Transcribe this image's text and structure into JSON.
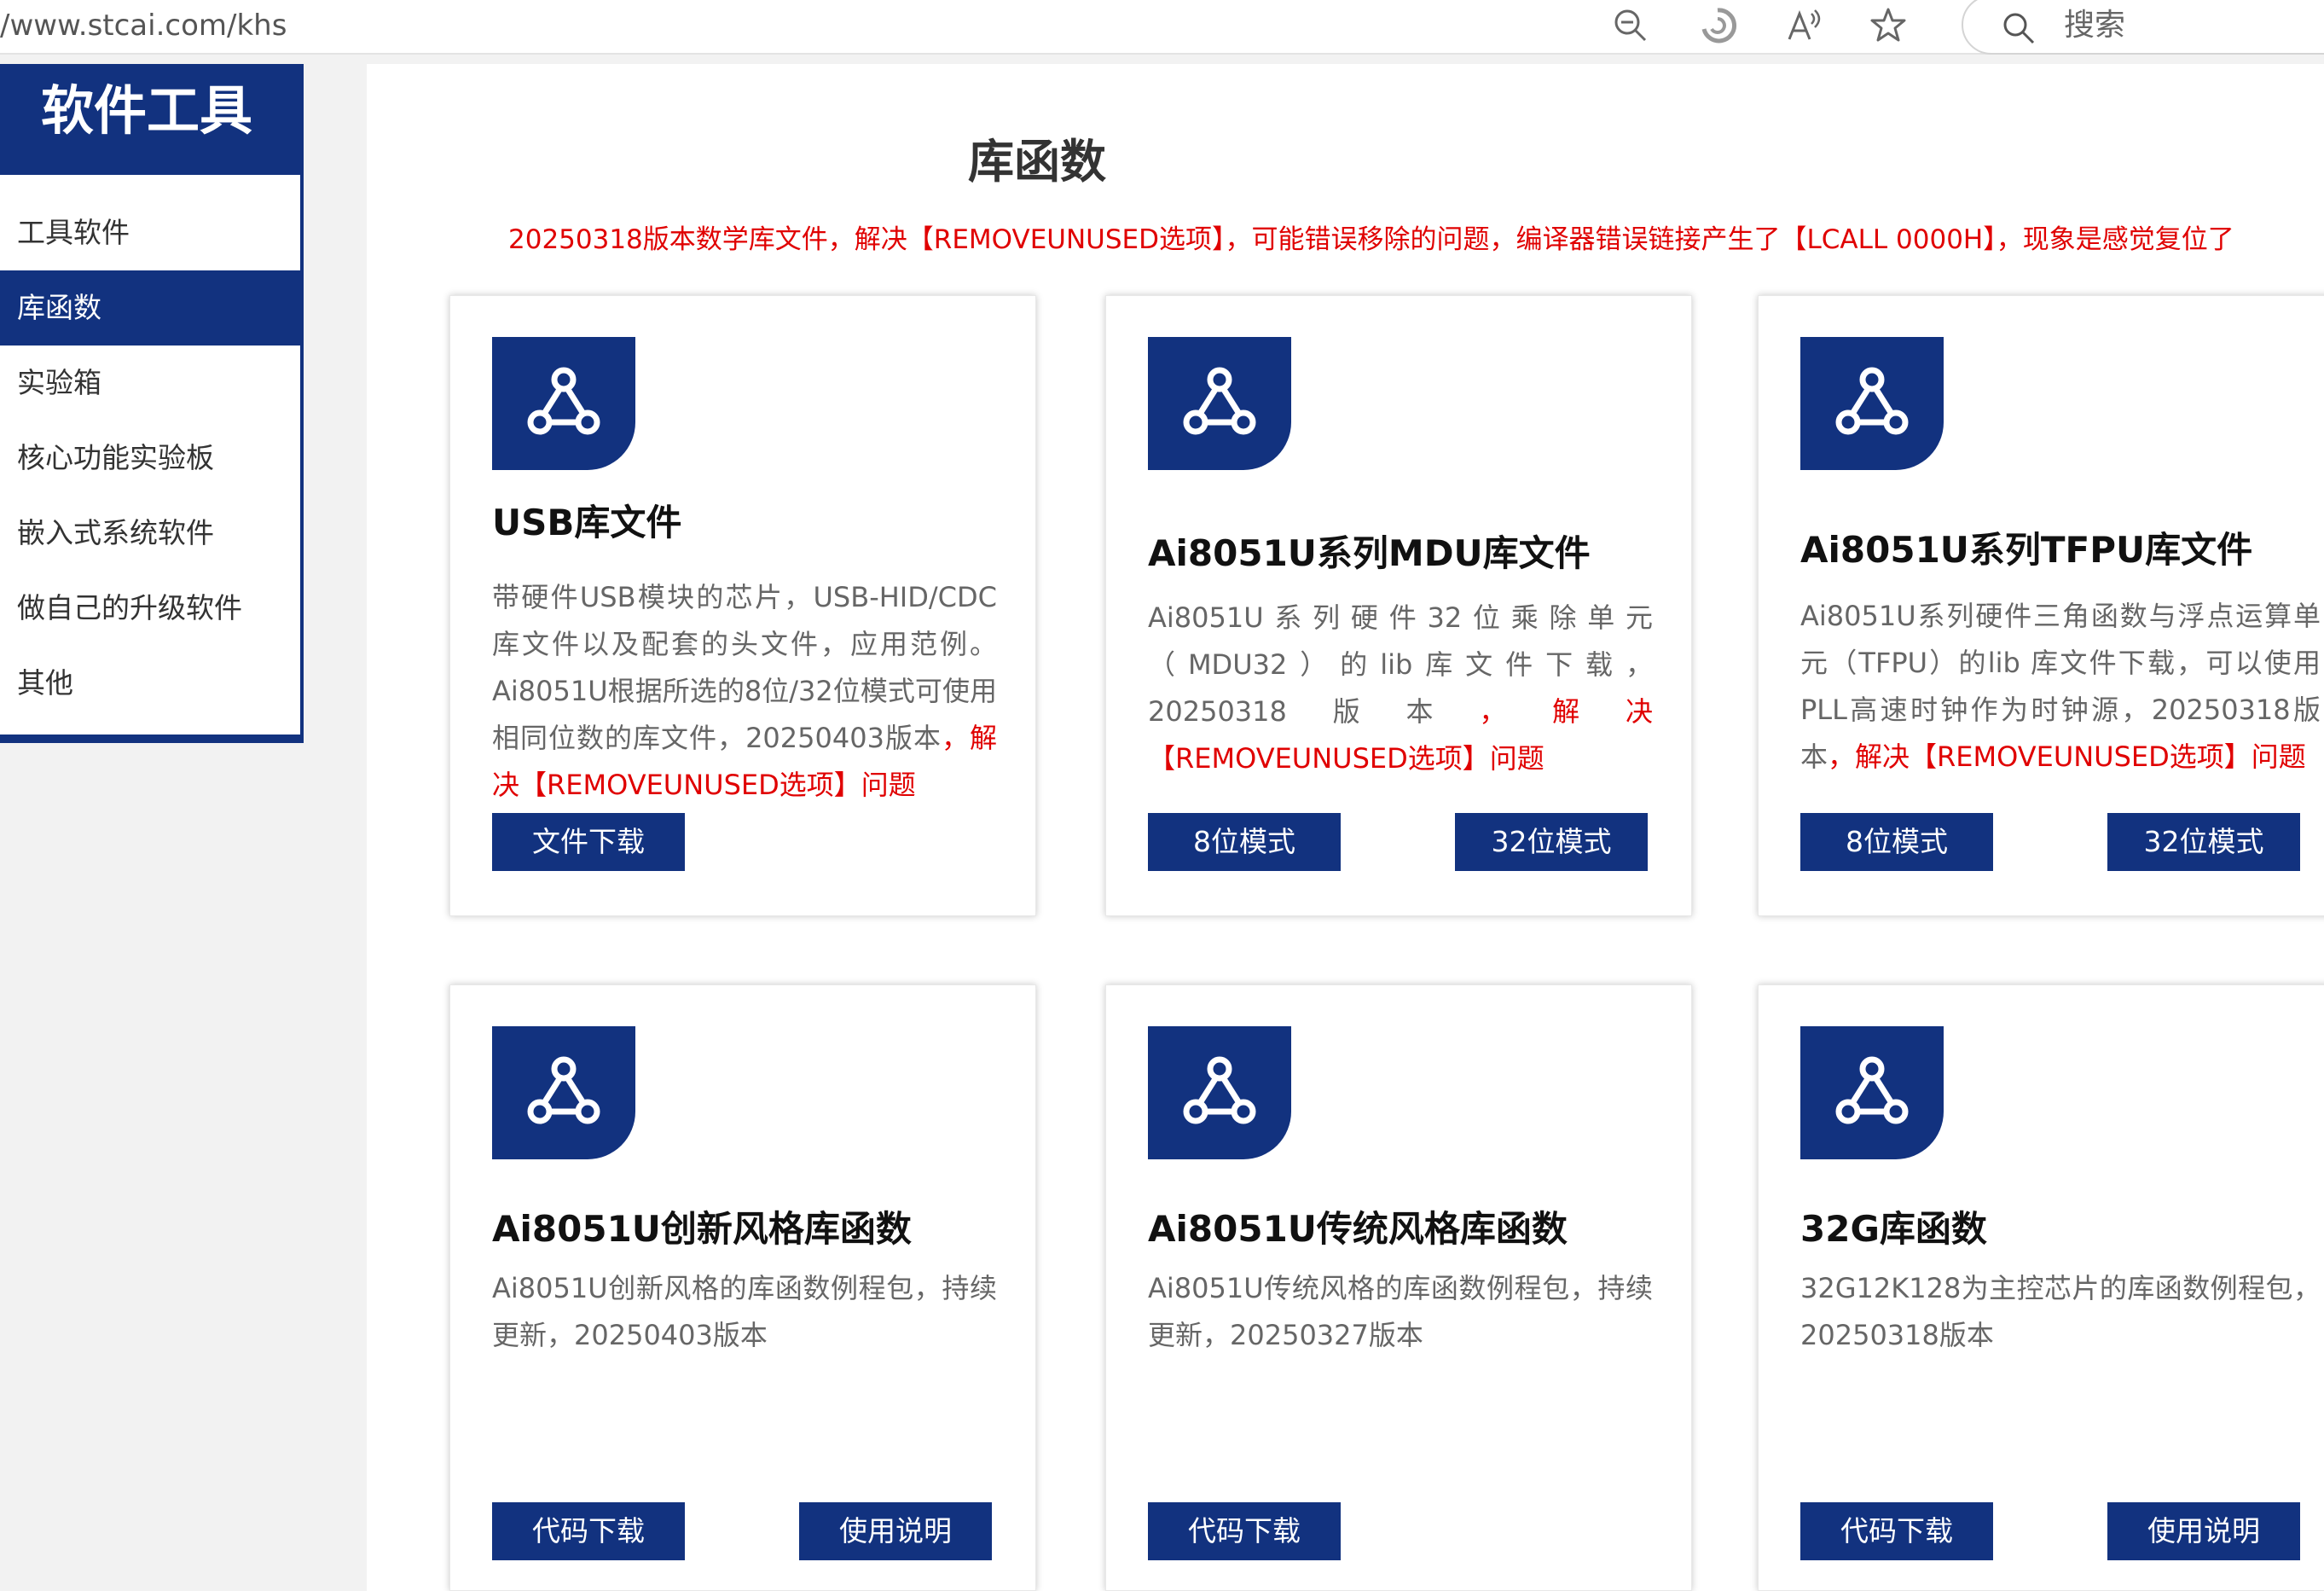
{
  "browser": {
    "url": "/www.stcai.com/khs",
    "search_placeholder": "搜索"
  },
  "sidebar": {
    "title": "软件工具",
    "items": [
      {
        "label": "工具软件"
      },
      {
        "label": "库函数"
      },
      {
        "label": "实验箱"
      },
      {
        "label": "核心功能实验板"
      },
      {
        "label": "嵌入式系统软件"
      },
      {
        "label": "做自己的升级软件"
      },
      {
        "label": "其他"
      }
    ]
  },
  "main": {
    "title": "库函数",
    "notice": "20250318版本数学库文件，解决【REMOVEUNUSED选项】，可能错误移除的问题，编译器错误链接产生了【LCALL  0000H】，现象是感觉复位了",
    "cards": [
      {
        "title": "USB库文件",
        "desc": "带硬件USB模块的芯片，USB-HID/CDC库文件以及配套的头文件，应用范例。Ai8051U根据所选的8位/32位模式可使用相同位数的库文件，20250403版本",
        "desc_red": "，解决【REMOVEUNUSED选项】问题",
        "buttons": [
          "文件下载"
        ]
      },
      {
        "title": "Ai8051U系列MDU库文件",
        "desc": "Ai8051U系列硬件32位乘除单元（MDU32）的lib库文件下载，20250318版本",
        "desc_red": "，解决【REMOVEUNUSED选项】问题",
        "buttons": [
          "8位模式",
          "32位模式"
        ]
      },
      {
        "title": "Ai8051U系列TFPU库文件",
        "desc": "Ai8051U系列硬件三角函数与浮点运算单元（TFPU）的lib 库文件下载，可以使用PLL高速时钟作为时钟源，20250318版本",
        "desc_red": "，解决【REMOVEUNUSED选项】问题",
        "buttons": [
          "8位模式",
          "32位模式"
        ]
      },
      {
        "title": "Ai8051U创新风格库函数",
        "desc": "Ai8051U创新风格的库函数例程包，持续更新，20250403版本",
        "desc_red": "",
        "buttons": [
          "代码下载",
          "使用说明"
        ]
      },
      {
        "title": "Ai8051U传统风格库函数",
        "desc": "Ai8051U传统风格的库函数例程包，持续更新，20250327版本",
        "desc_red": "",
        "buttons": [
          "代码下载"
        ]
      },
      {
        "title": "32G库函数",
        "desc": "32G12K128为主控芯片的库函数例程包，20250318版本",
        "desc_red": "",
        "buttons": [
          "代码下载",
          "使用说明"
        ]
      }
    ]
  },
  "colors": {
    "brand_blue": "#12327f",
    "notice_red": "#e00000"
  },
  "icons": [
    "zoom-out-icon",
    "refresh-icon",
    "read-aloud-icon",
    "favorite-star-icon",
    "search-icon",
    "share-nodes-icon"
  ]
}
